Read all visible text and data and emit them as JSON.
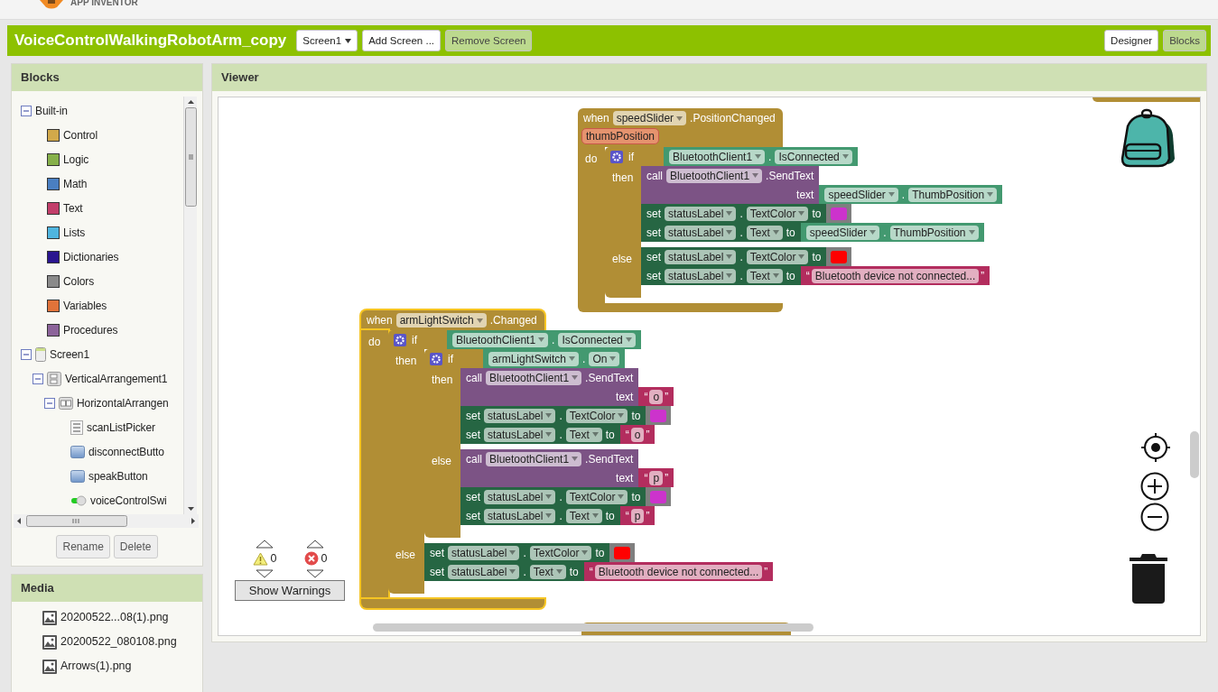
{
  "header": {
    "logo_text": "APP INVENTOR"
  },
  "toolbar": {
    "project": "VoiceControlWalkingRobotArm_copy",
    "screen_button": "Screen1",
    "buttons": [
      {
        "label": "Add Screen ...",
        "disabled": false
      },
      {
        "label": "Remove Screen",
        "disabled": true
      }
    ],
    "views": [
      {
        "label": "Designer",
        "selected": false
      },
      {
        "label": "Blocks",
        "selected": true
      }
    ]
  },
  "blocks_panel": {
    "title": "Blocks",
    "tree": [
      {
        "label": "Built-in",
        "kind": "folder",
        "expanded": true,
        "children": [
          {
            "label": "Control",
            "kind": "category",
            "color": "#d2a94a"
          },
          {
            "label": "Logic",
            "kind": "category",
            "color": "#86b04a"
          },
          {
            "label": "Math",
            "kind": "category",
            "color": "#4a7fc1"
          },
          {
            "label": "Text",
            "kind": "category",
            "color": "#c23e6a"
          },
          {
            "label": "Lists",
            "kind": "category",
            "color": "#4fb5df"
          },
          {
            "label": "Dictionaries",
            "kind": "category",
            "color": "#2a158f"
          },
          {
            "label": "Colors",
            "kind": "category",
            "color": "#8a8a8a"
          },
          {
            "label": "Variables",
            "kind": "category",
            "color": "#e0733a"
          },
          {
            "label": "Procedures",
            "kind": "category",
            "color": "#8c649a"
          }
        ]
      },
      {
        "label": "Screen1",
        "kind": "screen",
        "expanded": true,
        "children": [
          {
            "label": "VerticalArrangement1",
            "kind": "vertical",
            "expanded": true,
            "children": [
              {
                "label": "HorizontalArrangen",
                "kind": "horizontal",
                "expanded": true,
                "children": [
                  {
                    "label": "scanListPicker",
                    "kind": "listpicker"
                  },
                  {
                    "label": "disconnectButto",
                    "kind": "button"
                  },
                  {
                    "label": "speakButton",
                    "kind": "button"
                  },
                  {
                    "label": "voiceControlSwi",
                    "kind": "switch"
                  }
                ]
              }
            ]
          }
        ]
      }
    ],
    "buttons": [
      "Rename",
      "Delete"
    ]
  },
  "media_panel": {
    "title": "Media",
    "items": [
      "20200522...08(1).png",
      "20200522_080108.png",
      "Arrows(1).png"
    ]
  },
  "viewer": {
    "title": "Viewer",
    "blocks": [
      {
        "kind": "event",
        "selected": false,
        "when": "when",
        "component": "speedSlider",
        "event": ".PositionChanged",
        "params": [
          "thumbPosition"
        ],
        "do": "do",
        "body": [
          {
            "kind": "if",
            "if": "if",
            "condition": {
              "kind": "getter",
              "component": "BluetoothClient1",
              "dot": ".",
              "property": "IsConnected"
            },
            "branches": [
              {
                "label": "then",
                "body": [
                  {
                    "kind": "call",
                    "call": "call",
                    "component": "BluetoothClient1",
                    "method": ".SendText",
                    "arg_label": "text",
                    "arg": {
                      "kind": "getter",
                      "component": "speedSlider",
                      "dot": ".",
                      "property": "ThumbPosition"
                    }
                  },
                  {
                    "kind": "set",
                    "set": "set",
                    "component": "statusLabel",
                    "dot": ".",
                    "property": "TextColor",
                    "to": "to",
                    "value": {
                      "kind": "color",
                      "color": "#cc33cc"
                    }
                  },
                  {
                    "kind": "set",
                    "set": "set",
                    "component": "statusLabel",
                    "dot": ".",
                    "property": "Text",
                    "to": "to",
                    "value": {
                      "kind": "getter",
                      "component": "speedSlider",
                      "dot": ".",
                      "property": "ThumbPosition"
                    }
                  }
                ]
              },
              {
                "label": "else",
                "body": [
                  {
                    "kind": "set",
                    "set": "set",
                    "component": "statusLabel",
                    "dot": ".",
                    "property": "TextColor",
                    "to": "to",
                    "value": {
                      "kind": "color",
                      "color": "#ff0000"
                    }
                  },
                  {
                    "kind": "set",
                    "set": "set",
                    "component": "statusLabel",
                    "dot": ".",
                    "property": "Text",
                    "to": "to",
                    "value": {
                      "kind": "text",
                      "open": "“",
                      "value": "Bluetooth device not connected...",
                      "close": "”"
                    }
                  }
                ]
              }
            ]
          }
        ]
      },
      {
        "kind": "event",
        "selected": true,
        "when": "when",
        "component": "armLightSwitch",
        "event": ".Changed",
        "do": "do",
        "body": [
          {
            "kind": "if",
            "if": "if",
            "condition": {
              "kind": "getter",
              "component": "BluetoothClient1",
              "dot": ".",
              "property": "IsConnected"
            },
            "branches": [
              {
                "label": "then",
                "body": [
                  {
                    "kind": "if",
                    "if": "if",
                    "condition": {
                      "kind": "getter",
                      "component": "armLightSwitch",
                      "dot": ".",
                      "property": "On"
                    },
                    "branches": [
                      {
                        "label": "then",
                        "body": [
                          {
                            "kind": "call",
                            "call": "call",
                            "component": "BluetoothClient1",
                            "method": ".SendText",
                            "arg_label": "text",
                            "arg": {
                              "kind": "text",
                              "open": "“",
                              "value": "o",
                              "close": "”"
                            }
                          },
                          {
                            "kind": "set",
                            "set": "set",
                            "component": "statusLabel",
                            "dot": ".",
                            "property": "TextColor",
                            "to": "to",
                            "value": {
                              "kind": "color",
                              "color": "#cc33cc"
                            }
                          },
                          {
                            "kind": "set",
                            "set": "set",
                            "component": "statusLabel",
                            "dot": ".",
                            "property": "Text",
                            "to": "to",
                            "value": {
                              "kind": "text",
                              "open": "“",
                              "value": "o",
                              "close": "”"
                            }
                          }
                        ]
                      },
                      {
                        "label": "else",
                        "body": [
                          {
                            "kind": "call",
                            "call": "call",
                            "component": "BluetoothClient1",
                            "method": ".SendText",
                            "arg_label": "text",
                            "arg": {
                              "kind": "text",
                              "open": "“",
                              "value": "p",
                              "close": "”"
                            }
                          },
                          {
                            "kind": "set",
                            "set": "set",
                            "component": "statusLabel",
                            "dot": ".",
                            "property": "TextColor",
                            "to": "to",
                            "value": {
                              "kind": "color",
                              "color": "#cc33cc"
                            }
                          },
                          {
                            "kind": "set",
                            "set": "set",
                            "component": "statusLabel",
                            "dot": ".",
                            "property": "Text",
                            "to": "to",
                            "value": {
                              "kind": "text",
                              "open": "“",
                              "value": "p",
                              "close": "”"
                            }
                          }
                        ]
                      }
                    ]
                  }
                ]
              },
              {
                "label": "else",
                "body": [
                  {
                    "kind": "set",
                    "set": "set",
                    "component": "statusLabel",
                    "dot": ".",
                    "property": "TextColor",
                    "to": "to",
                    "value": {
                      "kind": "color",
                      "color": "#ff0000"
                    }
                  },
                  {
                    "kind": "set",
                    "set": "set",
                    "component": "statusLabel",
                    "dot": ".",
                    "property": "Text",
                    "to": "to",
                    "value": {
                      "kind": "text",
                      "open": "“",
                      "value": "Bluetooth device not connected...",
                      "close": "”"
                    }
                  }
                ]
              }
            ]
          }
        ]
      }
    ],
    "warnings": {
      "warning_count": "0",
      "error_count": "0",
      "button": "Show Warnings"
    }
  }
}
